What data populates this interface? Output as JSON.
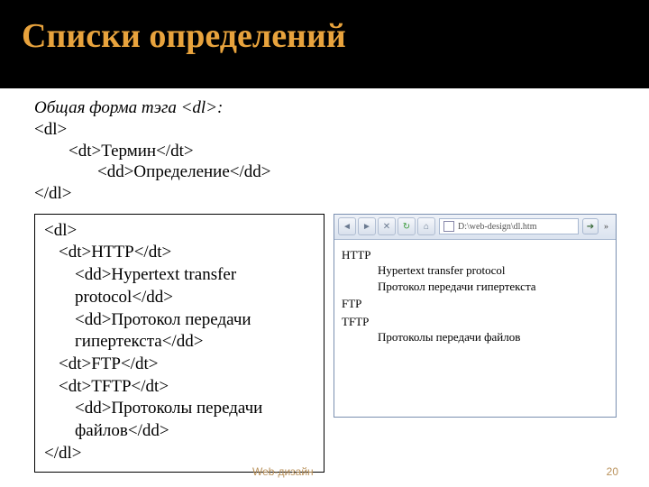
{
  "title": "Списки определений",
  "intro": {
    "lead": "Общая форма тэга <dl>:",
    "l1": "<dl>",
    "l2": "<dt>Термин</dt>",
    "l3": "<dd>Определение</dd>",
    "l4": "</dl>"
  },
  "code": {
    "l1": "<dl>",
    "l2": "<dt>HTTP</dt>",
    "l3": "<dd>Hypertext transfer",
    "l4": "protocol</dd>",
    "l5": "<dd>Протокол передачи",
    "l6": "гипертекста</dd>",
    "l7": "<dt>FTP</dt>",
    "l8": "<dt>TFTP</dt>",
    "l9": "<dd>Протоколы передачи",
    "l10": "файлов</dd>",
    "l11": "</dl>"
  },
  "browser": {
    "address": "D:\\web-design\\dl.htm",
    "render": {
      "dt1": "HTTP",
      "dd1": "Hypertext transfer protocol",
      "dd2": "Протокол передачи гипертекста",
      "dt2": "FTP",
      "dt3": "TFTP",
      "dd3": "Протоколы передачи файлов"
    }
  },
  "footer": {
    "left": "Web-дизайн",
    "right": "20"
  }
}
